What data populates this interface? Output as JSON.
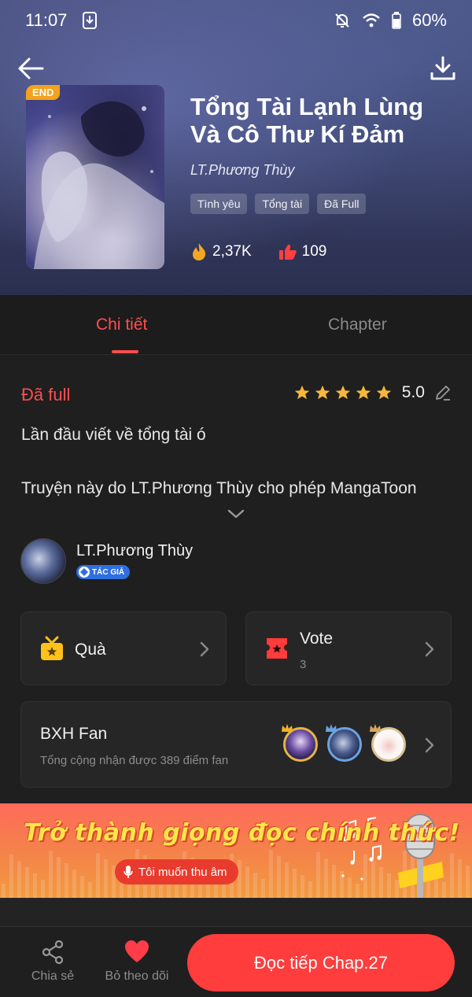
{
  "status_bar": {
    "time": "11:07",
    "battery": "60%",
    "icons": [
      "download-notification-icon",
      "bell-off-icon",
      "wifi-icon",
      "battery-icon"
    ]
  },
  "header": {
    "back_icon": "arrow-left-icon",
    "download_icon": "download-icon"
  },
  "book": {
    "cover_badge": "END",
    "title": "Tổng Tài Lạnh Lùng Và Cô Thư Kí Đảm",
    "author": "LT.Phương Thùy",
    "tags": [
      "Tình yêu",
      "Tổng tài",
      "Đã Full"
    ],
    "views": "2,37K",
    "likes": "109"
  },
  "tabs": {
    "detail": "Chi tiết",
    "chapter": "Chapter"
  },
  "detail": {
    "status": "Đã full",
    "rating": "5.0",
    "rating_stars": 5,
    "description_line1": "Lần đầu viết về tổng tài ó",
    "description_line2": "Truyện này do LT.Phương Thùy cho phép MangaToon"
  },
  "author_section": {
    "name": "LT.Phương Thùy",
    "badge": "TÁC GIẢ"
  },
  "cards": {
    "gift_label": "Quà",
    "vote_label": "Vote",
    "vote_count": "3"
  },
  "fan_ranking": {
    "title": "BXH Fan",
    "subtitle": "Tổng cộng nhận được 389 điểm fan"
  },
  "banner": {
    "title": "Trở thành giọng đọc chính thức!",
    "button": "Tôi muốn thu âm"
  },
  "bottom_bar": {
    "share": "Chia sẻ",
    "unfollow": "Bỏ theo dõi",
    "read_button": "Đọc tiếp Chap.27"
  },
  "colors": {
    "accent": "#ff4d4f",
    "primary_button": "#ff3d3d",
    "star": "#f6b73c",
    "background": "#1f1f1f",
    "card": "#262626"
  }
}
